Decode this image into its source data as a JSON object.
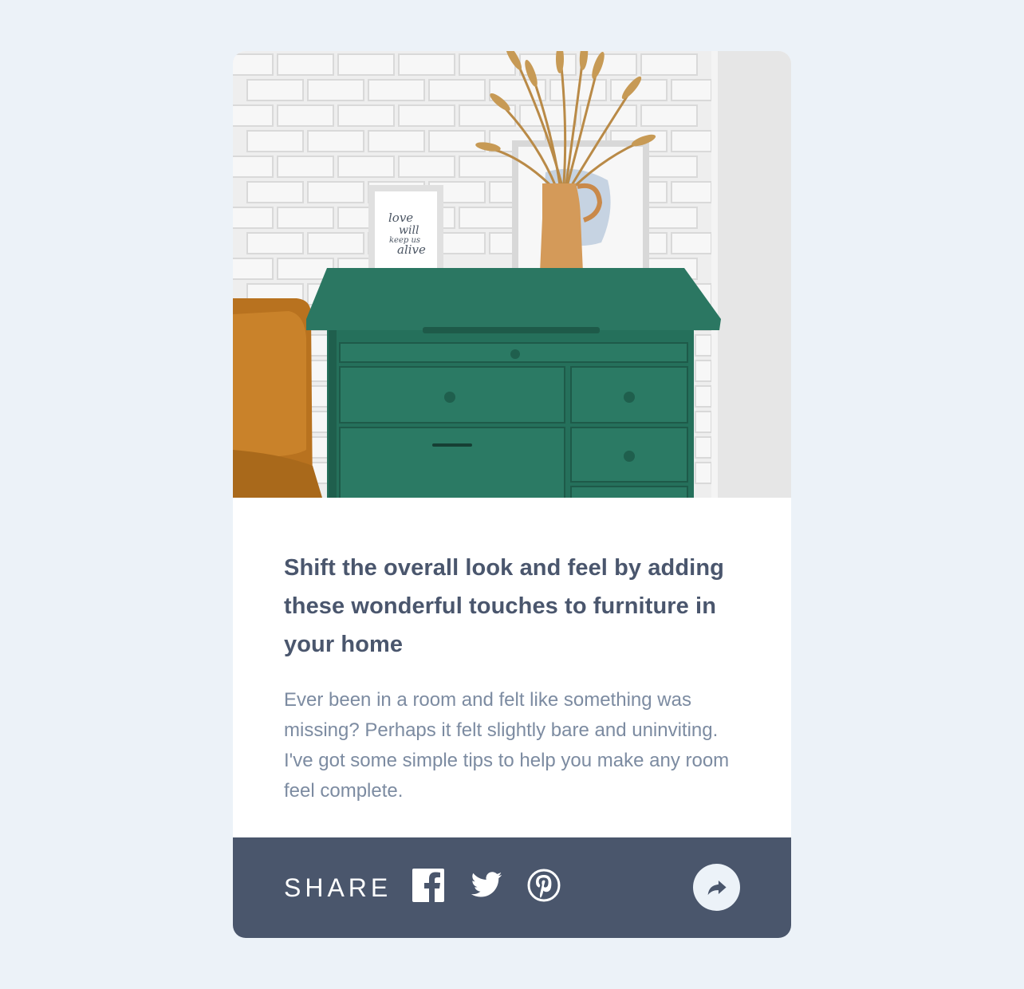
{
  "article": {
    "title": "Shift the overall look and feel by adding these wonderful touches to furniture in your home",
    "description": "Ever been in a room and felt like something was missing? Perhaps it felt slightly bare and uninviting. I've got some simple tips to help you make any room feel complete."
  },
  "footer": {
    "share_label": "SHARE",
    "icons": [
      "facebook-icon",
      "twitter-icon",
      "pinterest-icon",
      "share-arrow-icon"
    ]
  },
  "photo": {
    "frame_text": [
      "love",
      "will",
      "keep us",
      "alive"
    ]
  },
  "colors": {
    "page_background": "#ecf2f8",
    "card_background": "#ffffff",
    "footer_background": "#4a566c",
    "title_color": "#4a566d",
    "description_color": "#7c8ba1"
  }
}
